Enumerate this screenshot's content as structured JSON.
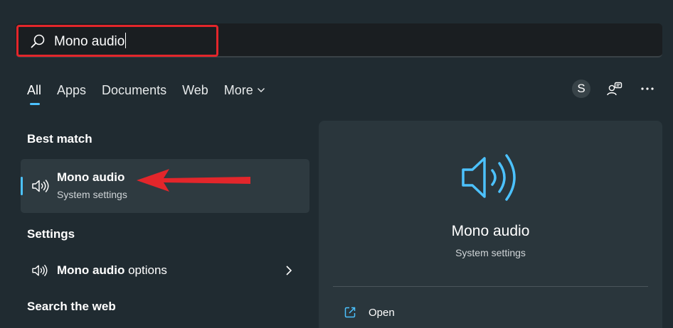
{
  "search": {
    "value": "Mono audio"
  },
  "tabs": [
    {
      "label": "All",
      "active": true
    },
    {
      "label": "Apps"
    },
    {
      "label": "Documents"
    },
    {
      "label": "Web"
    },
    {
      "label": "More"
    }
  ],
  "account": {
    "initial": "S"
  },
  "icons": {
    "search": "search-icon",
    "chevron_down": "chevron-down-icon",
    "switch_account": "switch-account-icon",
    "more": "more-options-icon",
    "speaker": "speaker-icon",
    "chevron_right": "chevron-right-icon",
    "open": "open-external-icon"
  },
  "left": {
    "best_match_heading": "Best match",
    "best_match": {
      "title": "Mono audio",
      "subtitle": "System settings"
    },
    "settings_heading": "Settings",
    "settings_item": {
      "bold": "Mono audio",
      "rest": " options"
    },
    "web_heading": "Search the web"
  },
  "right": {
    "title": "Mono audio",
    "subtitle": "System settings",
    "actions": [
      {
        "label": "Open"
      }
    ]
  },
  "colors": {
    "accent": "#4cc2ff",
    "annotation_red": "#e3262b",
    "background": "#202b31",
    "panel": "#2a363c"
  }
}
